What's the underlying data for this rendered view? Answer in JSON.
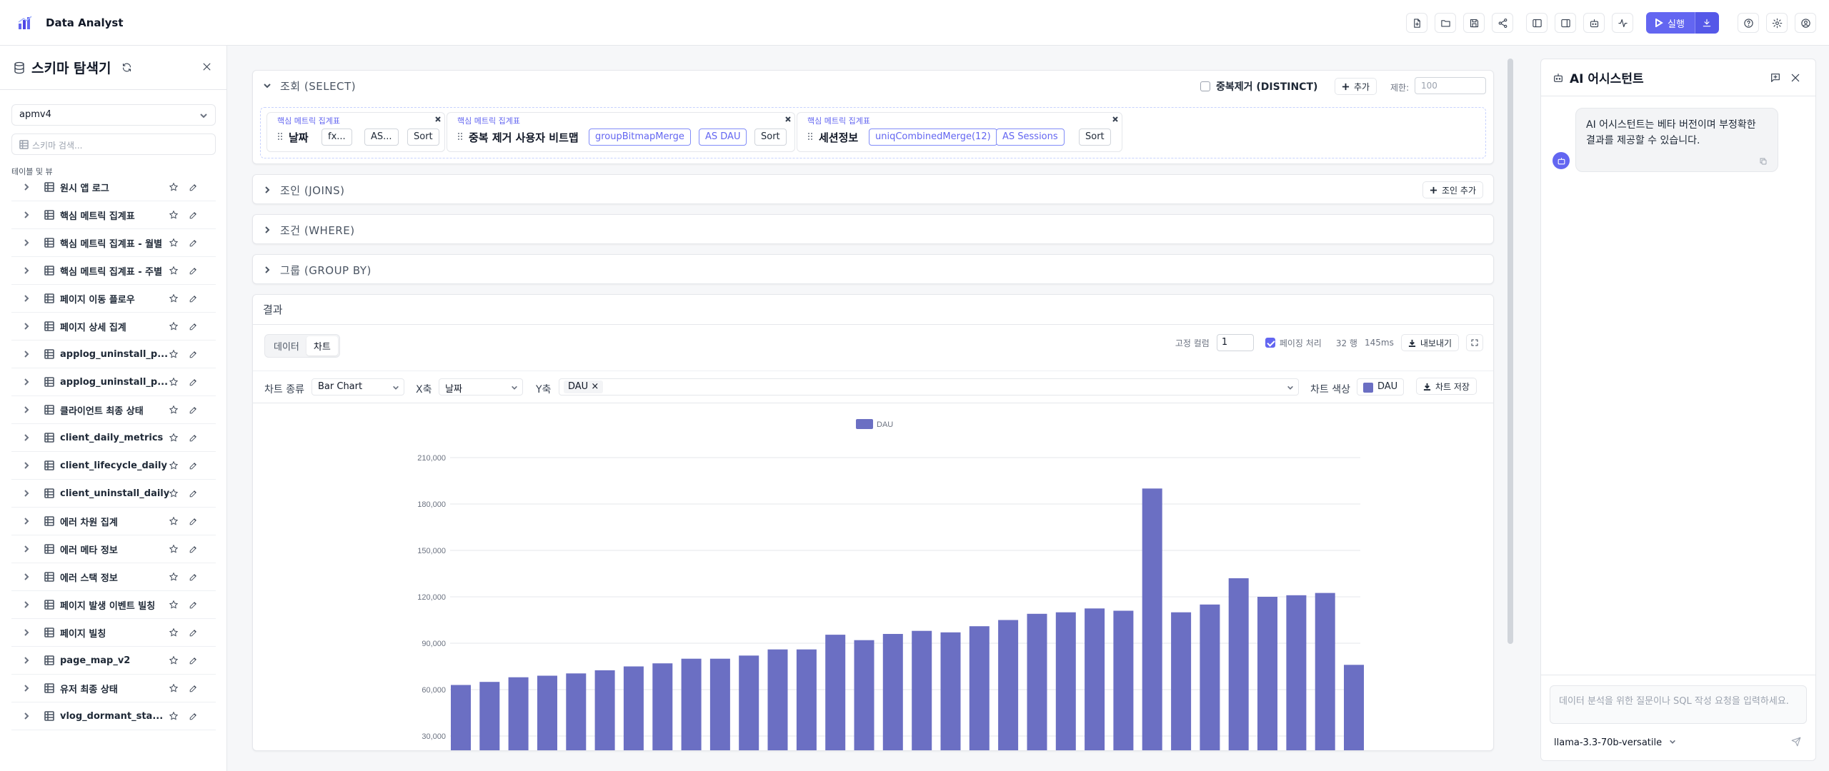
{
  "app": {
    "title": "Data Analyst"
  },
  "toolbar": {
    "run_label": "실행"
  },
  "sidebar": {
    "title": "스키마 탐색기",
    "database": "apmv4",
    "search_placeholder": "스키마 검색...",
    "section_label": "테이블 및 뷰",
    "items": [
      {
        "label": "원시 앱 로그"
      },
      {
        "label": "핵심 메트릭 집계표"
      },
      {
        "label": "핵심 메트릭 집계표 - 월별"
      },
      {
        "label": "핵심 메트릭 집계표 - 주별"
      },
      {
        "label": "페이지 이동 플로우"
      },
      {
        "label": "페이지 상세 집계"
      },
      {
        "label": "applog_uninstall_p..."
      },
      {
        "label": "applog_uninstall_p..."
      },
      {
        "label": "클라이언트 최종 상태"
      },
      {
        "label": "client_daily_metrics"
      },
      {
        "label": "client_lifecycle_daily"
      },
      {
        "label": "client_uninstall_daily"
      },
      {
        "label": "에러 차원 집계"
      },
      {
        "label": "에러 메타 정보"
      },
      {
        "label": "에러 스택 정보"
      },
      {
        "label": "페이지 발생 이벤트 빌칭"
      },
      {
        "label": "페이지 빌칭"
      },
      {
        "label": "page_map_v2"
      },
      {
        "label": "유저 최종 상태"
      },
      {
        "label": "vlog_dormant_sta..."
      }
    ]
  },
  "query": {
    "select": {
      "title": "조회 (SELECT)",
      "distinct_label": "중복제거 (DISTINCT)",
      "add_label": "추가",
      "limit_label": "제한:",
      "limit_placeholder": "100",
      "columns": [
        {
          "source": "핵심 메트릭 집계표",
          "name": "날짜",
          "func": "fx...",
          "alias": "AS...",
          "sort": "Sort"
        },
        {
          "source": "핵심 메트릭 집계표",
          "name": "중복 제거 사용자 비트맵",
          "func": "groupBitmapMerge",
          "alias": "AS DAU",
          "sort": "Sort"
        },
        {
          "source": "핵심 메트릭 집계표",
          "name": "세션정보",
          "func": "uniqCombinedMerge(12)",
          "alias": "AS Sessions",
          "sort": "Sort"
        }
      ]
    },
    "joins": {
      "title": "조인 (JOINS)",
      "add_label": "조인 추가"
    },
    "where": {
      "title": "조건 (WHERE)"
    },
    "group_by": {
      "title": "그룹 (GROUP BY)"
    }
  },
  "results": {
    "title": "결과",
    "tabs": [
      {
        "label": "데이터"
      },
      {
        "label": "차트"
      }
    ],
    "fixed_cols_label": "고정 컬럼",
    "fixed_cols_value": "1",
    "paging_label": "페이징 처리",
    "row_count": "32 행",
    "elapsed": "145ms",
    "export_label": "내보내기",
    "chart_type_label": "차트 종류",
    "chart_type_value": "Bar Chart",
    "x_label": "X축",
    "x_value": "날짜",
    "y_label": "Y축",
    "y_tag": "DAU",
    "color_label": "차트 색상",
    "color_series": "DAU",
    "save_chart_label": "차트 저장"
  },
  "chart_data": {
    "type": "bar",
    "color": "#6b6fc3",
    "legend": "DAU",
    "legend_position": "top-center",
    "grid": true,
    "ylim": [
      30000,
      210000
    ],
    "yticks": [
      "30,000",
      "60,000",
      "90,000",
      "120,000",
      "150,000",
      "180,000",
      "210,000"
    ],
    "series": [
      {
        "name": "DAU",
        "values": [
          63000,
          65000,
          68000,
          69000,
          70500,
          72500,
          75000,
          77000,
          80000,
          80000,
          82000,
          86000,
          86000,
          95500,
          92000,
          96000,
          98000,
          97000,
          101000,
          105000,
          109000,
          110000,
          112500,
          111000,
          190000,
          110000,
          115000,
          132000,
          120000,
          121000,
          122500,
          76000
        ]
      }
    ]
  },
  "ai": {
    "title": "AI 어시스턴트",
    "message": "AI 어시스턴트는 베타 버전이며 부정확한 결과를 제공할 수 있습니다.",
    "input_placeholder": "데이터 분석을 위한 질문이나 SQL 작성 요청을 입력하세요.",
    "model": "llama-3.3-70b-versatile"
  }
}
